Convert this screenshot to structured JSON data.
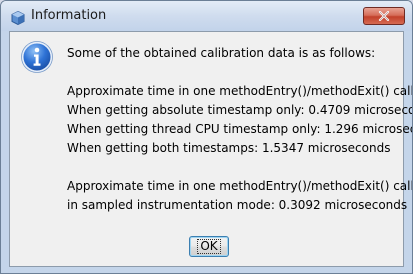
{
  "window": {
    "title": "Information",
    "close_icon": "close-icon",
    "title_icon": "java-app-icon"
  },
  "dialog": {
    "icon": "info-icon",
    "colors": {
      "info_icon_blue": "#1f5fc4",
      "close_button_red": "#c2412b",
      "focus_border": "#3c7fb1"
    },
    "lines": [
      "Some of the obtained calibration data is as follows:",
      "",
      "Approximate time in one methodEntry()/methodExit() call pair:",
      "When getting absolute timestamp only: 0.4709 microseconds",
      "When getting thread CPU timestamp only: 1.296 microseconds",
      "When getting both timestamps: 1.5347 microseconds",
      "",
      "Approximate time in one methodEntry()/methodExit() call pair",
      "in sampled instrumentation mode: 0.3092 microseconds"
    ],
    "ok_label": "OK"
  }
}
